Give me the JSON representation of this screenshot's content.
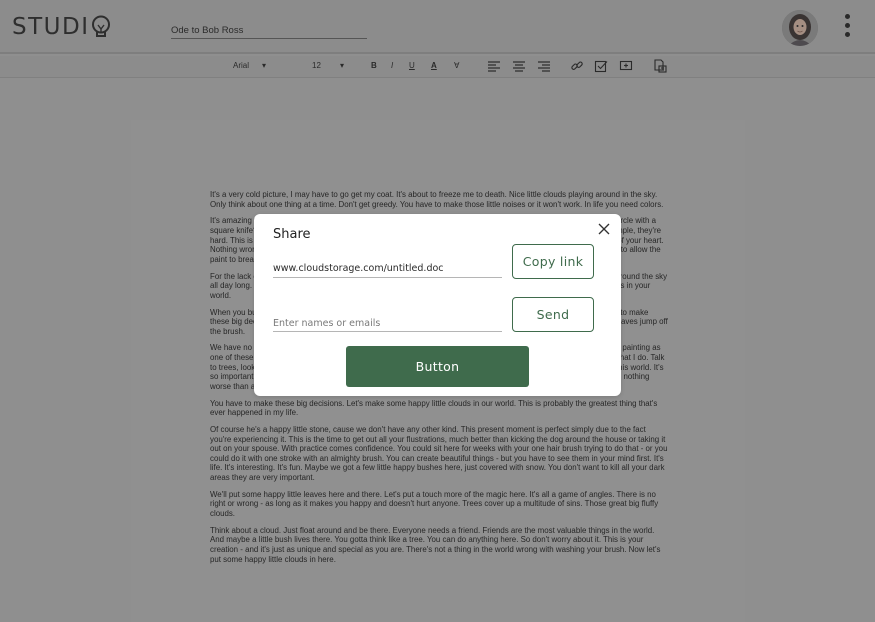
{
  "app": {
    "logo": "STUDI"
  },
  "document": {
    "title": "Ode to Bob Ross"
  },
  "toolbar": {
    "font": "Arial",
    "font_size": "12",
    "dropdown_glyph": "▾",
    "bold": "B",
    "italic": "I",
    "underline": "U",
    "text_color": "A",
    "highlight": "∀"
  },
  "share_dialog": {
    "title": "Share",
    "link_value": "www.cloudstorage.com/untitled.doc",
    "copy_label": "Copy link",
    "names_placeholder": "Enter names or emails",
    "send_label": "Send",
    "main_button_label": "Button"
  },
  "page_paragraphs": [
    "It's a very cold picture, I may have to go get my coat. It's about to freeze me to death. Nice little clouds playing around in the sky. Only think about one thing at a time. Don't get greedy. You have to make those little noises or it won't work. In life you need colors.",
    "It's amazing what you can do with a little love in your heart. Those great big fluffy clouds. How do you make a round circle with a square knife? That's your challenge for the day. Everybody needs a friend. You do what it wants. Mountains are so simple, they're hard. This is probably the greatest thing to happen in my life. Anything that you can do. This painting comes right out of your heart. Nothing wrong with that. Sometimes it's nice to have an accident; great in life, but we can learn a lot from it. You have to allow the paint to break to make it beautiful. In painting, and in life, let it go.",
    "For the lack of a better word I call them hangy downs. Put light against light - you have nothing. Little clouds floating around the sky all day long. That's what makes life fun. That you can make these decisions. You can create all these happy little things in your world.",
    "When you buy that first tube of paint it gives you an artist license. That's the way you keep your world. Don't be afraid to make these big decisions. Once you start, they sort of just make themselves. Let's get crazy, what the heck. Just let these leaves jump off the brush.",
    "We have no limits to our world. We're only limited by our imagination. You'll know it when it happens, once you started painting as one of these little landscapes. Go out on a limb - that's where the fruit is. There's no right or wrong. Anybody can do what I do. Talk to trees, look at the birds. Whatever it takes. In your world you can create anything you desire. There are no limits in this world. It's so important to do something every day that will make you happy. If you overwork it you become a cloud killer. There's nothing worse than a cloud killer.",
    "You have to make these big decisions. Let's make some happy little clouds in our world. This is probably the greatest thing that's ever happened in my life.",
    "Of course he's a happy little stone, cause we don't have any other kind. This present moment is perfect simply due to the fact you're experiencing it. This is the time to get out all your flustrations, much better than kicking the dog around the house or taking it out on your spouse. With practice comes confidence. You could sit here for weeks with your one hair brush trying to do that - or you could do it with one stroke with an almighty brush. You can create beautiful things - but you have to see them in your mind first. It's life. It's interesting. It's fun. Maybe we got a few little happy bushes here, just covered with snow. You don't want to kill all your dark areas they are very important.",
    "We'll put some happy little leaves here and there. Let's put a touch more of the magic here. It's all a game of angles. There is no right or wrong - as long as it makes you happy and doesn't hurt anyone. Trees cover up a multitude of sins. Those great big fluffy clouds.",
    "Think about a cloud. Just float around and be there. Everyone needs a friend. Friends are the most valuable things in the world. And maybe a little bush lives there. You gotta think like a tree. You can do anything here. So don't worry about it. This is your creation - and it's just as unique and special as you are. There's not a thing in the world wrong with washing your brush. Now let's put some happy little clouds in here."
  ],
  "colors": {
    "accent": "#3f6b4c",
    "backdrop": "#8f8f8f",
    "dialog": "#ffffff"
  }
}
